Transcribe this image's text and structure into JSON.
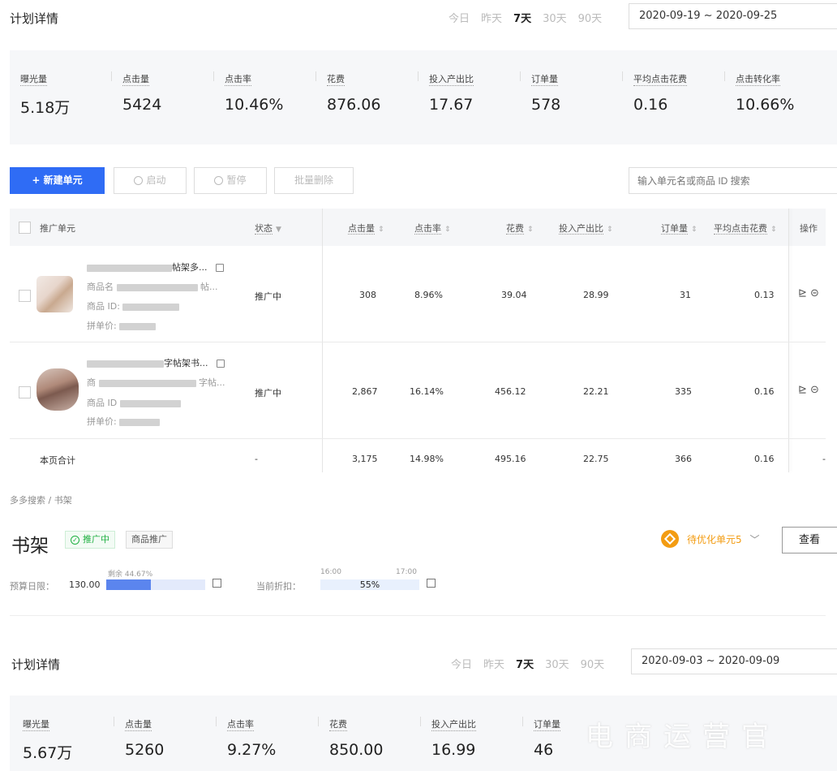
{
  "top": {
    "title": "计划详情",
    "periods": [
      "今日",
      "昨天",
      "7天",
      "30天",
      "90天"
    ],
    "active_period": "7天",
    "date_range": "2020-09-19 ~ 2020-09-25",
    "metrics": [
      {
        "label": "曝光量",
        "value": "5.18万"
      },
      {
        "label": "点击量",
        "value": "5424"
      },
      {
        "label": "点击率",
        "value": "10.46%"
      },
      {
        "label": "花费",
        "value": "876.06"
      },
      {
        "label": "投入产出比",
        "value": "17.67"
      },
      {
        "label": "订单量",
        "value": "578"
      },
      {
        "label": "平均点击花费",
        "value": "0.16"
      },
      {
        "label": "点击转化率",
        "value": "10.66%"
      }
    ]
  },
  "toolbar": {
    "new_unit": "+ 新建单元",
    "start": "启动",
    "pause": "暂停",
    "batch_delete": "批量删除",
    "search_placeholder": "输入单元名或商品 ID 搜索"
  },
  "table": {
    "headers": {
      "unit": "推广单元",
      "status": "状态",
      "clicks": "点击量",
      "ctr": "点击率",
      "cost": "花费",
      "roi": "投入产出比",
      "orders": "订单量",
      "cpc": "平均点击花费",
      "ops": "操作"
    },
    "rows": [
      {
        "name_suffix": "帖架多...",
        "goods_name_label": "商品名",
        "goods_name_tail": "帖...",
        "goods_id_label": "商品 ID:",
        "price_label": "拼单价:",
        "status": "推广中",
        "clicks": "308",
        "ctr": "8.96%",
        "cost": "39.04",
        "roi": "28.99",
        "orders": "31",
        "cpc": "0.13"
      },
      {
        "name_suffix": "字帖架书...",
        "goods_name_label": "商",
        "goods_name_tail": "字帖...",
        "goods_id_label": "商品 ID",
        "price_label": "拼单价:",
        "status": "推广中",
        "clicks": "2,867",
        "ctr": "16.14%",
        "cost": "456.12",
        "roi": "22.21",
        "orders": "335",
        "cpc": "0.16"
      }
    ],
    "total": {
      "label": "本页合计",
      "status": "-",
      "clicks": "3,175",
      "ctr": "14.98%",
      "cost": "495.16",
      "roi": "22.75",
      "orders": "366",
      "cpc": "0.16",
      "ops": "-"
    }
  },
  "plan": {
    "breadcrumb": "多多搜索 / 书架",
    "name": "书架",
    "status_tag": "推广中",
    "type_tag": "商品推广",
    "optimize_label": "待优化单元5",
    "view_button": "查看",
    "budget_label": "预算日限：",
    "budget_value": "130.00",
    "budget_remaining_label": "剩余 44.67%",
    "budget_used_fraction": 0.4533,
    "discount_label": "当前折扣：",
    "discount_time_start": "16:00",
    "discount_time_end": "17:00",
    "discount_value": "55%"
  },
  "bottom": {
    "title": "计划详情",
    "periods": [
      "今日",
      "昨天",
      "7天",
      "30天",
      "90天"
    ],
    "active_period": "7天",
    "date_range": "2020-09-03 ~ 2020-09-09",
    "metrics": [
      {
        "label": "曝光量",
        "value": "5.67万"
      },
      {
        "label": "点击量",
        "value": "5260"
      },
      {
        "label": "点击率",
        "value": "9.27%"
      },
      {
        "label": "花费",
        "value": "850.00"
      },
      {
        "label": "投入产出比",
        "value": "16.99"
      },
      {
        "label": "订单量",
        "value": "46"
      }
    ]
  },
  "watermark": "电商运营官",
  "colors": {
    "primary": "#2f6cf5",
    "success": "#1fb041",
    "warning": "#f39c12"
  }
}
